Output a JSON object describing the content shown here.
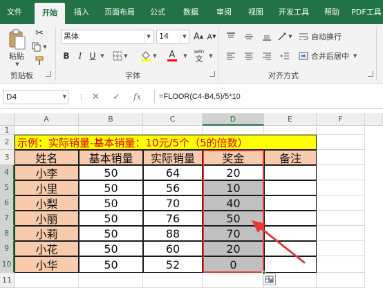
{
  "ribbon_tabs": [
    "文件",
    "开始",
    "插入",
    "页面布局",
    "公式",
    "数据",
    "审阅",
    "视图",
    "开发工具",
    "帮助",
    "PDF工具"
  ],
  "active_tab": "开始",
  "clipboard": {
    "paste_label": "粘贴",
    "group_label": "剪贴板"
  },
  "font": {
    "name": "黑体",
    "size": "14",
    "bold": "B",
    "italic": "I",
    "underline": "U",
    "font_grow": "A",
    "font_shrink": "A",
    "font_color": "A",
    "wen": "wén",
    "wen_char": "文",
    "group_label": "字体"
  },
  "alignment": {
    "wrap_text": "自动换行",
    "merge_center": "合并后居中",
    "group_label": "对齐方式"
  },
  "formula_bar": {
    "name_box": "D4",
    "fx": "fx",
    "formula": "=FLOOR(C4-B4,5)/5*10"
  },
  "sheet": {
    "columns": [
      "A",
      "B",
      "C",
      "D",
      "E",
      "F"
    ],
    "selected_column": "D",
    "rows": [
      "1",
      "2",
      "3",
      "4",
      "5",
      "6",
      "7",
      "8",
      "9",
      "10",
      "11"
    ],
    "title": "示例：实际销量-基本销量：10元/5个（5的倍数）",
    "headers": [
      "姓名",
      "基本销量",
      "实际销量",
      "奖金",
      "备注"
    ],
    "records": [
      {
        "name": "小李",
        "base": "50",
        "actual": "64",
        "bonus": "20"
      },
      {
        "name": "小里",
        "base": "50",
        "actual": "56",
        "bonus": "10"
      },
      {
        "name": "小梨",
        "base": "50",
        "actual": "70",
        "bonus": "40"
      },
      {
        "name": "小丽",
        "base": "50",
        "actual": "76",
        "bonus": "50"
      },
      {
        "name": "小莉",
        "base": "50",
        "actual": "88",
        "bonus": "70"
      },
      {
        "name": "小花",
        "base": "50",
        "actual": "60",
        "bonus": "20"
      },
      {
        "name": "小华",
        "base": "50",
        "actual": "52",
        "bonus": "0"
      }
    ]
  },
  "colors": {
    "excel_green": "#217346",
    "title_fill": "#ffff00",
    "title_text": "#e00000",
    "header_fill": "#f8cbad",
    "name_fill": "#f8cbad",
    "selection_fill": "#c0c0c0",
    "annotation_red": "#e53935"
  },
  "annotation_arrow_icon": "arrow-icon"
}
